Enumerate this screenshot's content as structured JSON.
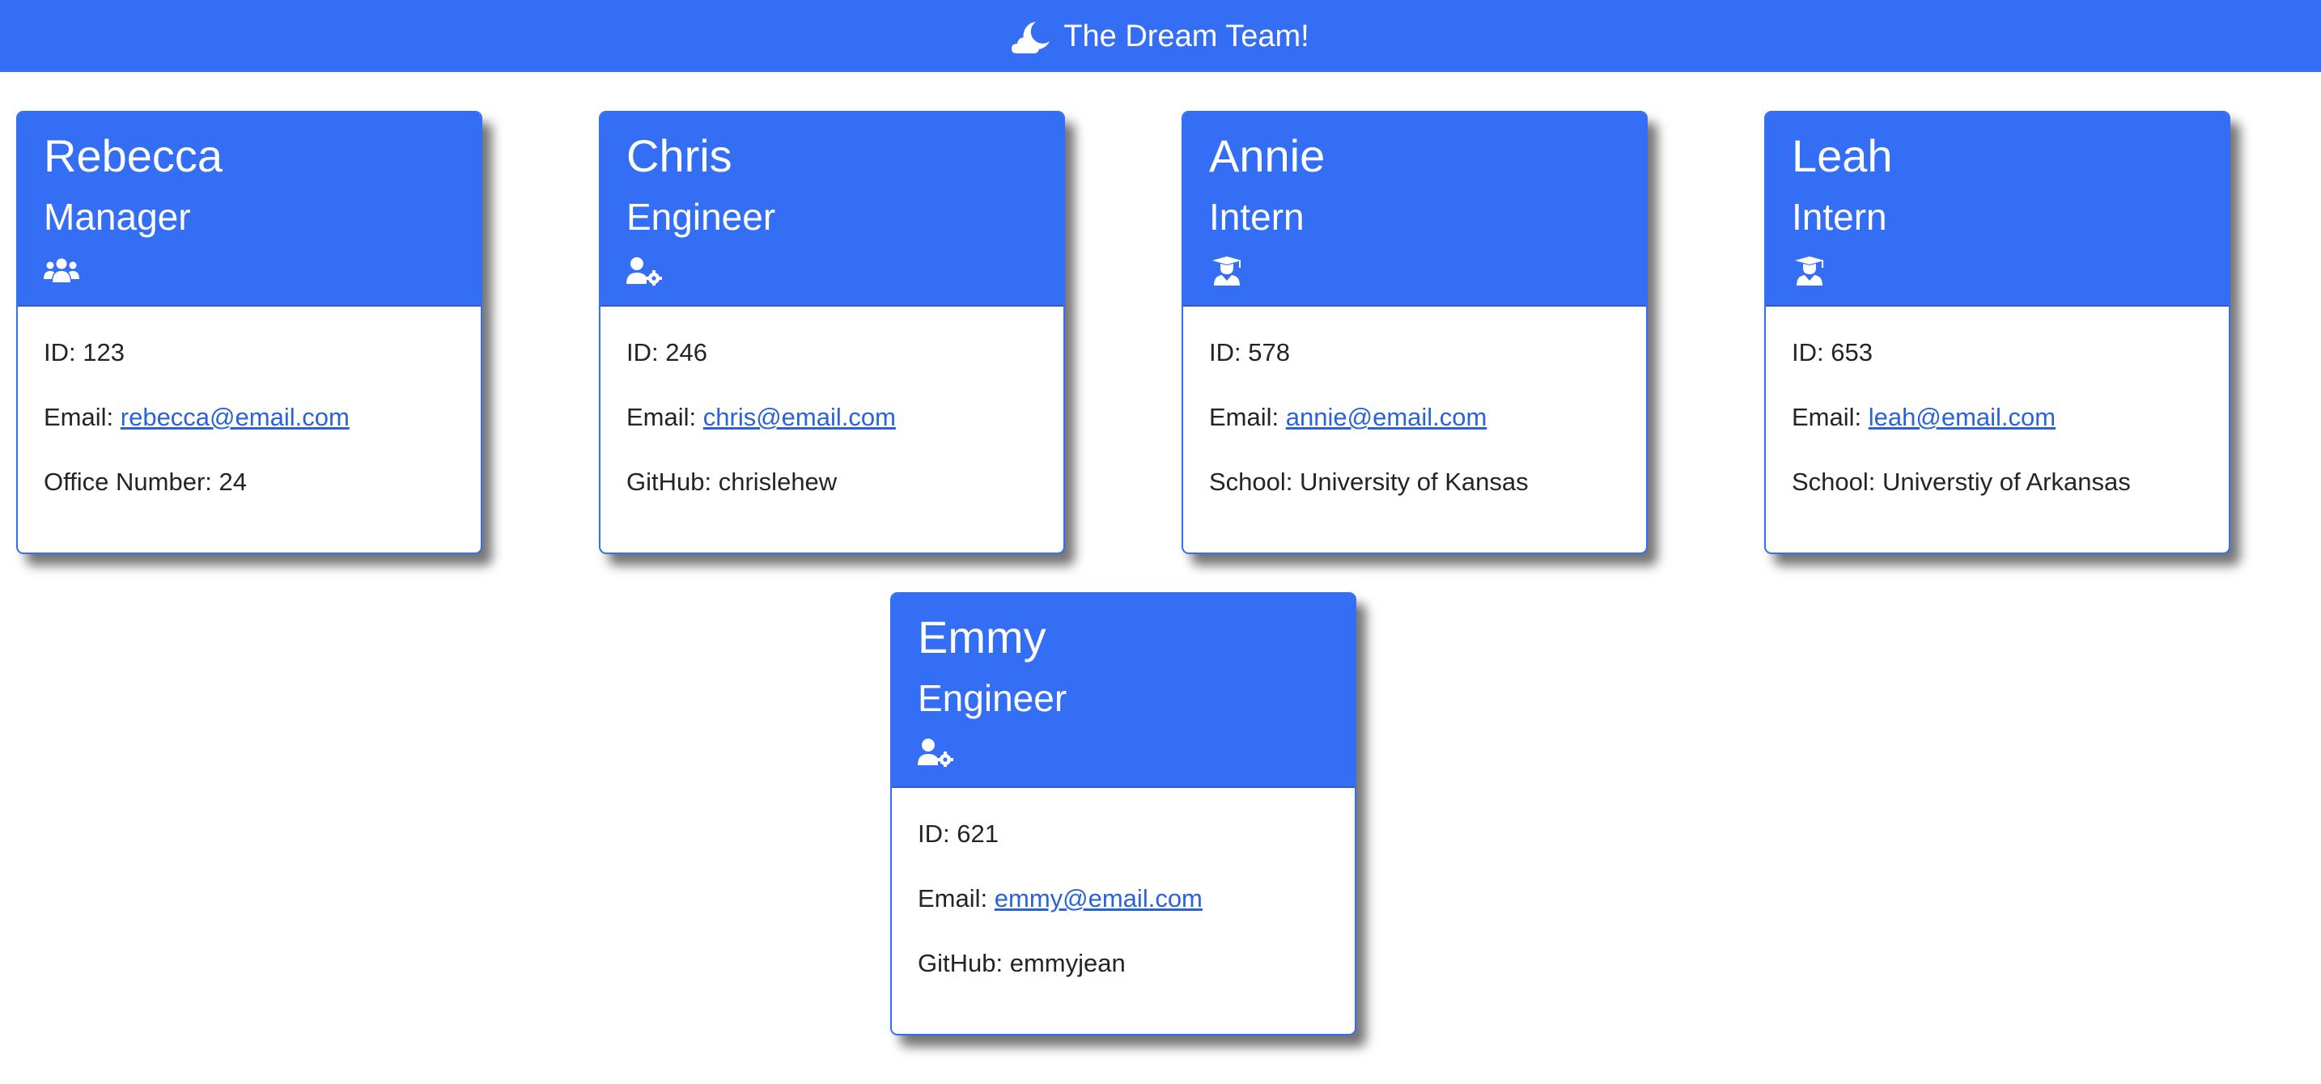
{
  "navbar": {
    "title": "The Dream Team!",
    "icon": "cloud-moon-icon",
    "color": "#336ef4"
  },
  "cards": [
    {
      "name": "Rebecca",
      "role": "Manager",
      "icon": "users-icon",
      "id_label": "ID:",
      "id": "123",
      "email_label": "Email:",
      "email": "rebecca@email.com",
      "extra_label": "Office Number:",
      "extra": "24"
    },
    {
      "name": "Chris",
      "role": "Engineer",
      "icon": "user-gear-icon",
      "id_label": "ID:",
      "id": "246",
      "email_label": "Email:",
      "email": "chris@email.com",
      "extra_label": "GitHub:",
      "extra": "chrislehew"
    },
    {
      "name": "Annie",
      "role": "Intern",
      "icon": "user-graduate-icon",
      "id_label": "ID:",
      "id": "578",
      "email_label": "Email:",
      "email": "annie@email.com",
      "extra_label": "School:",
      "extra": "University of Kansas"
    },
    {
      "name": "Leah",
      "role": "Intern",
      "icon": "user-graduate-icon",
      "id_label": "ID:",
      "id": "653",
      "email_label": "Email:",
      "email": "leah@email.com",
      "extra_label": "School:",
      "extra": "Universtiy of Arkansas"
    },
    {
      "name": "Emmy",
      "role": "Engineer",
      "icon": "user-gear-icon",
      "id_label": "ID:",
      "id": "621",
      "email_label": "Email:",
      "email": "emmy@email.com",
      "extra_label": "GitHub:",
      "extra": "emmyjean"
    }
  ]
}
